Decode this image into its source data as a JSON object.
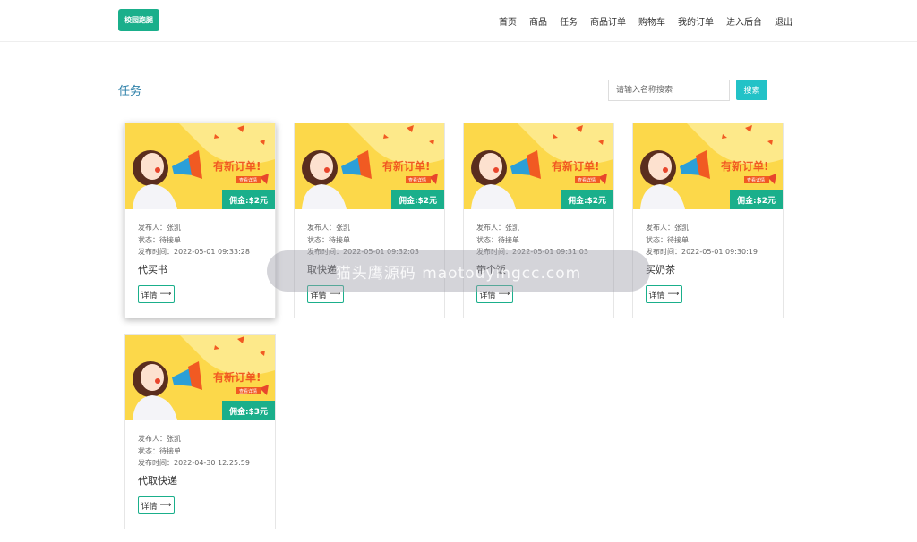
{
  "header": {
    "logo_text": "校园跑腿",
    "nav": [
      "首页",
      "商品",
      "任务",
      "商品订单",
      "购物车",
      "我的订单",
      "进入后台",
      "退出"
    ]
  },
  "main": {
    "title": "任务",
    "search_placeholder": "请输入名称搜索",
    "search_button": "搜索"
  },
  "banner": {
    "headline": "有新订单!",
    "sub": "查看详情"
  },
  "tasks": [
    {
      "commission": "佣金:$2元",
      "publisher": "发布人：张凯",
      "status": "状态：待接单",
      "time": "发布时间：2022-05-01 09:33:28",
      "name": "代买书",
      "detail": "详情"
    },
    {
      "commission": "佣金:$2元",
      "publisher": "发布人：张凯",
      "status": "状态：待接单",
      "time": "发布时间：2022-05-01 09:32:03",
      "name": "取快递",
      "detail": "详情"
    },
    {
      "commission": "佣金:$2元",
      "publisher": "发布人：张凯",
      "status": "状态：待接单",
      "time": "发布时间：2022-05-01 09:31:03",
      "name": "带个饭",
      "detail": "详情"
    },
    {
      "commission": "佣金:$2元",
      "publisher": "发布人：张凯",
      "status": "状态：待接单",
      "time": "发布时间：2022-05-01 09:30:19",
      "name": "买奶茶",
      "detail": "详情"
    },
    {
      "commission": "佣金:$3元",
      "publisher": "发布人：张凯",
      "status": "状态：待接单",
      "time": "发布时间：2022-04-30 12:25:59",
      "name": "代取快递",
      "detail": "详情"
    }
  ],
  "watermark": "猫头鹰源码 maotouyingcc.com",
  "icons": {
    "detail_arrow": "arrow-right-icon"
  },
  "colors": {
    "accent": "#1aaf8b",
    "search_button": "#22c2c7",
    "title": "#2b7fa8",
    "banner_bg": "#fcd84a",
    "banner_text": "#f15a22"
  }
}
